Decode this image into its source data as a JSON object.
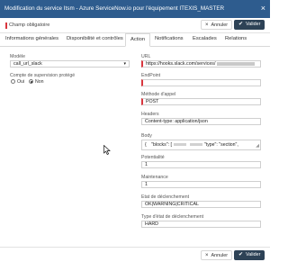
{
  "dialog": {
    "title": "Modification du service Itsm - Azure ServiceNow.io pour l'équipement ITEXIS_MASTER",
    "close_glyph": "×"
  },
  "required_note": "Champ obligatoire",
  "buttons": {
    "cancel_label": "Annuler",
    "validate_label": "Valider",
    "cancel_glyph": "×",
    "validate_glyph": "✔"
  },
  "tabs": [
    {
      "label": "Informations générales",
      "active": false
    },
    {
      "label": "Disponibilité et contrôles",
      "active": false
    },
    {
      "label": "Action",
      "active": true
    },
    {
      "label": "Notifications",
      "active": false
    },
    {
      "label": "Escalades",
      "active": false
    },
    {
      "label": "Relations",
      "active": false
    }
  ],
  "form": {
    "modele": {
      "label": "Modèle",
      "value": "call_url_slack"
    },
    "compte": {
      "label": "Compte de supervision protégé",
      "options": [
        "Oui",
        "Non"
      ],
      "selected": "Non"
    },
    "url": {
      "label": "URL",
      "value": "https://hooks.slack.com/services/"
    },
    "endpoint": {
      "label": "EndPoint",
      "value": ""
    },
    "methode": {
      "label": "Méthode d'appel",
      "value": "POST"
    },
    "headers": {
      "label": "Headers",
      "value": "Content-type: application/json"
    },
    "body": {
      "label": "Body",
      "value_start": "{",
      "value_part1": "\"blocks\": [",
      "value_part2": "\"type\": \"section\","
    },
    "potentialite": {
      "label": "Potentialité",
      "value": "1"
    },
    "maintenance": {
      "label": "Maintenance",
      "value": "1"
    },
    "etat": {
      "label": "Etat de déclenchement",
      "value": "OK|WARNING|CRITICAL"
    },
    "type_etat": {
      "label": "Type d'état de déclenchement",
      "value": "HARD"
    }
  },
  "colors": {
    "titlebar": "#2e5c8e",
    "validate_button": "#2d4256",
    "required_marker": "#d9363e"
  },
  "icons": {
    "close": "close-icon",
    "select": "chevron-down-icon",
    "cursor": "pointer-cursor"
  }
}
